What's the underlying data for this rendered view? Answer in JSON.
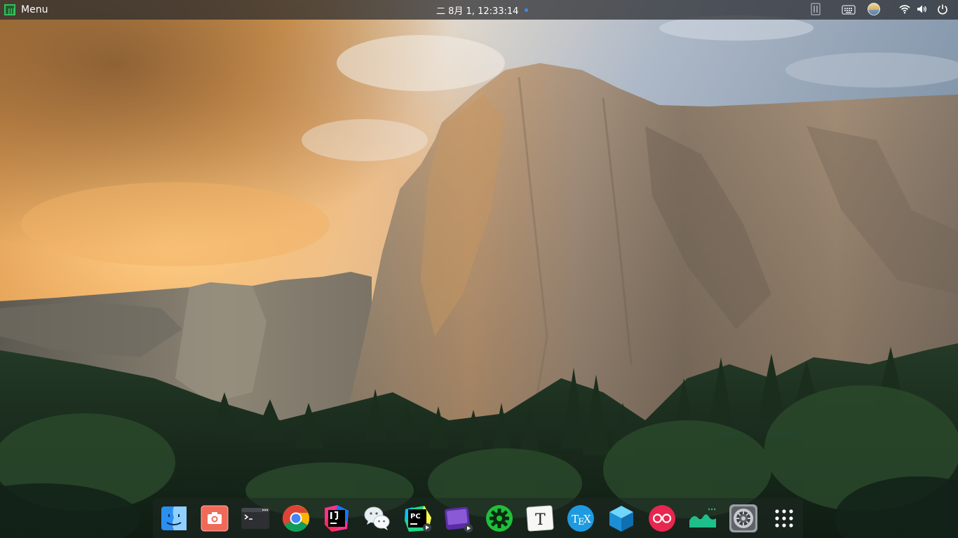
{
  "top_panel": {
    "menu_label": "Menu",
    "clock": "二 8月  1, 12:33:14",
    "tray_icons": [
      "task-manager-icon",
      "keyboard-icon",
      "weather-icon",
      "wifi-icon",
      "volume-icon",
      "power-icon"
    ]
  },
  "dock": {
    "apps": [
      "finder-icon",
      "screenshot-icon",
      "terminal-icon",
      "chrome-icon",
      "intellij-idea-icon",
      "wechat-icon",
      "pycharm-icon",
      "video-player-icon",
      "settings-gear-icon",
      "typora-icon",
      "tex-icon",
      "virtualbox-icon",
      "flickr-icon",
      "system-monitor-icon",
      "system-preferences-icon",
      "app-launcher-icon"
    ]
  },
  "colors": {
    "panel_bg": "#2a2c2e",
    "manjaro_green": "#35bf5c",
    "clock_dot": "#3c8ce6"
  }
}
